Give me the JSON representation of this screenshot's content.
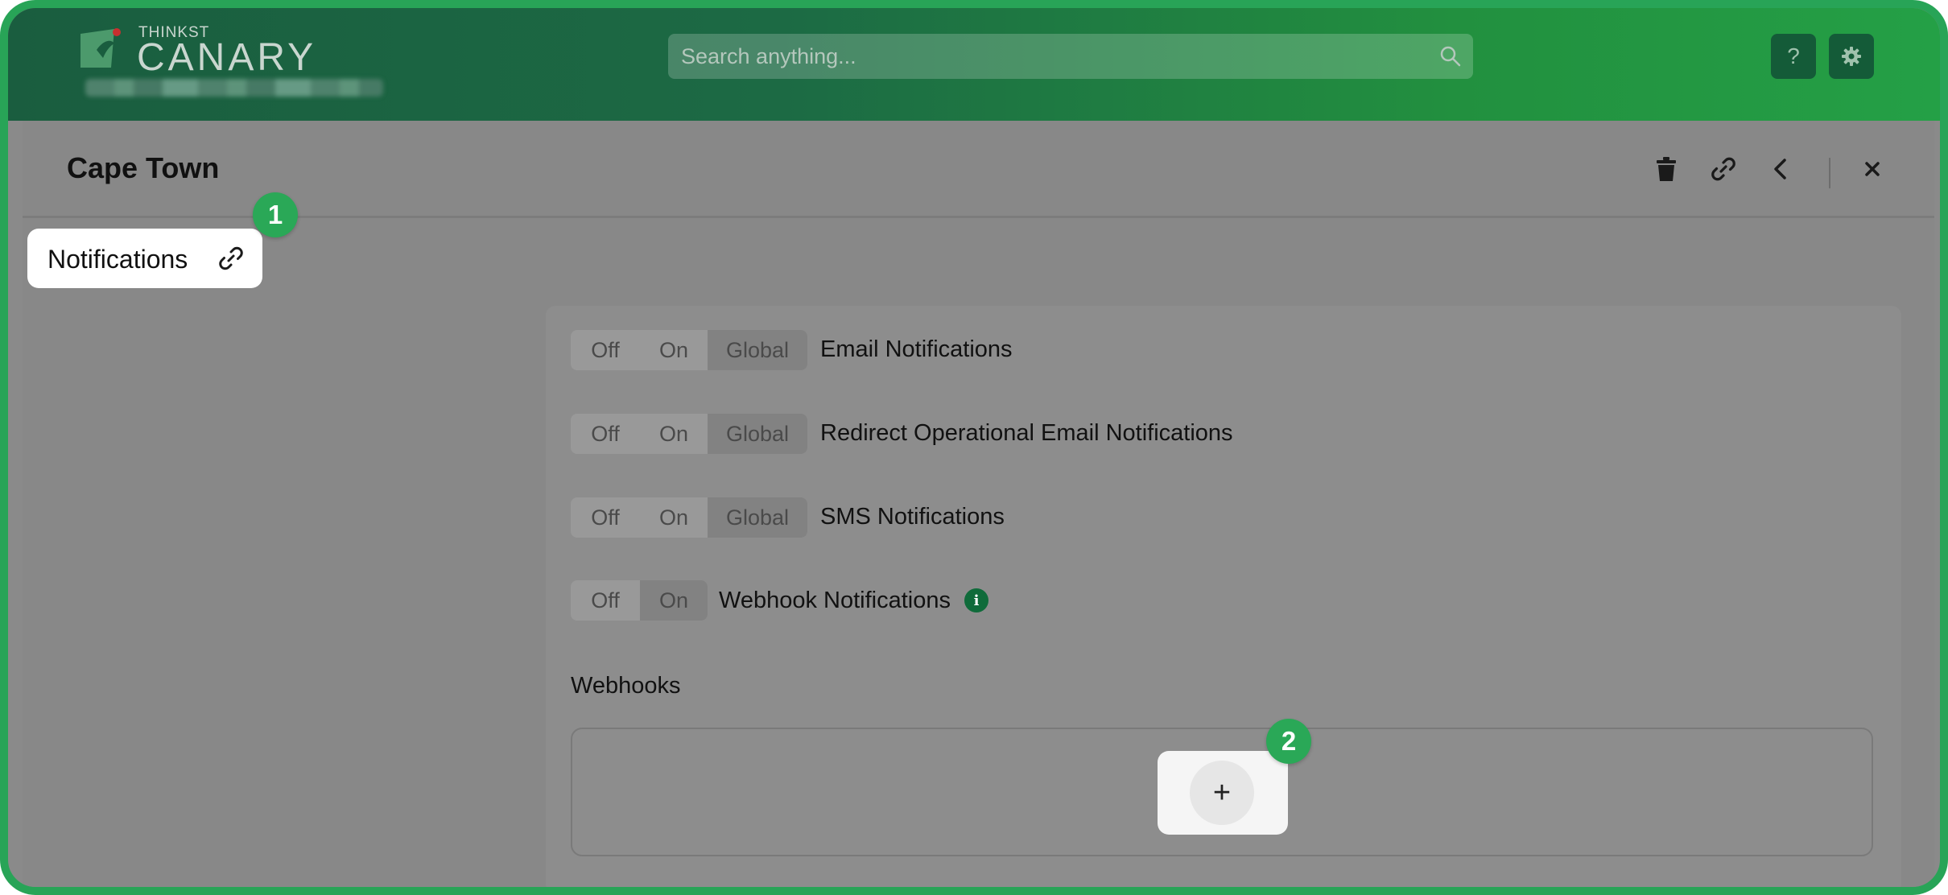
{
  "header": {
    "logo_small": "THINKST",
    "logo_big": "CANARY",
    "search_placeholder": "Search anything...",
    "help_label": "?"
  },
  "panel": {
    "title": "Cape Town",
    "icons": [
      "trash-icon",
      "link-icon",
      "chevron-left-icon",
      "close-icon"
    ]
  },
  "section": {
    "label": "Notifications"
  },
  "toggles": [
    {
      "options": [
        "Off",
        "On",
        "Global"
      ],
      "selected": "Global",
      "label": "Email Notifications"
    },
    {
      "options": [
        "Off",
        "On",
        "Global"
      ],
      "selected": "Global",
      "label": "Redirect Operational Email Notifications"
    },
    {
      "options": [
        "Off",
        "On",
        "Global"
      ],
      "selected": "Global",
      "label": "SMS Notifications"
    },
    {
      "options": [
        "Off",
        "On"
      ],
      "selected": "On",
      "label": "Webhook Notifications"
    }
  ],
  "webhooks": {
    "label": "Webhooks",
    "add_label": "+"
  },
  "callouts": [
    "1",
    "2"
  ],
  "colors": {
    "accent": "#28a457",
    "header_dark": "#1a5d3f",
    "info": "#0f6b3a"
  }
}
